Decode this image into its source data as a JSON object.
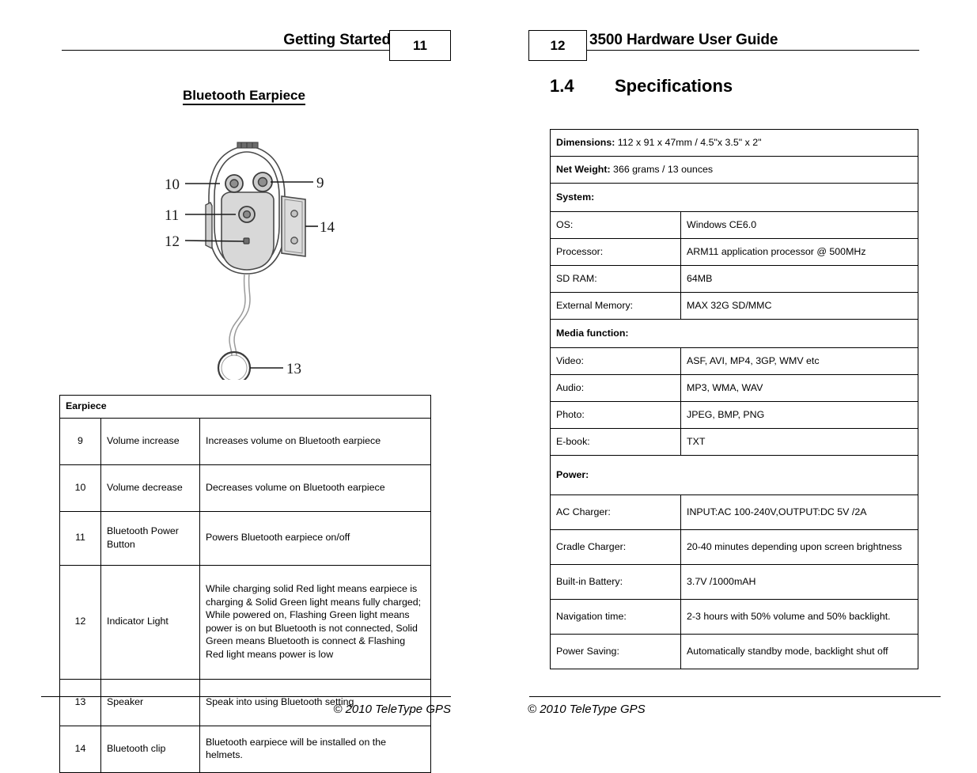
{
  "document": {
    "title": "3500 Hardware User Guide",
    "copyright": "© 2010 TeleType GPS"
  },
  "left_page": {
    "header": {
      "title": "Getting Started",
      "page_number": "11"
    },
    "section_title": "Bluetooth Earpiece",
    "figure": {
      "name": "bluetooth-earpiece-diagram",
      "callouts": [
        "9",
        "10",
        "11",
        "12",
        "13",
        "14"
      ]
    },
    "table": {
      "caption": "Earpiece",
      "rows": [
        {
          "num": "9",
          "part": "Volume increase",
          "desc": "Increases volume on Bluetooth earpiece"
        },
        {
          "num": "10",
          "part": "Volume decrease",
          "desc": "Decreases volume on Bluetooth earpiece"
        },
        {
          "num": "11",
          "part": "Bluetooth Power Button",
          "desc": "Powers Bluetooth earpiece on/off"
        },
        {
          "num": "12",
          "part": "Indicator Light",
          "desc": "While charging solid Red light means earpiece is charging & Solid Green light means fully charged; While powered on, Flashing Green light means power is on but Bluetooth is not connected, Solid Green means Bluetooth is connect & Flashing Red light means power is low"
        },
        {
          "num": "13",
          "part": "Speaker",
          "desc": "Speak into using Bluetooth setting"
        },
        {
          "num": "14",
          "part": "Bluetooth clip",
          "desc": "Bluetooth earpiece will be installed on the helmets."
        }
      ]
    },
    "footer": "© 2010 TeleType GPS"
  },
  "right_page": {
    "header": {
      "title": "3500 Hardware User Guide",
      "page_number": "12"
    },
    "heading": {
      "number": "1.4",
      "text": "Specifications"
    },
    "spec_table": {
      "rows": [
        {
          "type": "full",
          "label": "Dimensions:",
          "value": " 112 x 91 x 47mm / 4.5\"x 3.5\" x 2\""
        },
        {
          "type": "full",
          "label": "Net Weight:",
          "value": " 366 grams / 13 ounces"
        },
        {
          "type": "section",
          "label": "System:",
          "value": ""
        },
        {
          "type": "pair",
          "label": "OS:",
          "value": "Windows CE6.0"
        },
        {
          "type": "pair",
          "label": "Processor:",
          "value": "ARM11 application processor @ 500MHz"
        },
        {
          "type": "pair",
          "label": "SD RAM:",
          "value": "64MB"
        },
        {
          "type": "pair",
          "label": "External Memory:",
          "value": "MAX 32G SD/MMC"
        },
        {
          "type": "section",
          "label": "Media function:",
          "value": ""
        },
        {
          "type": "pair",
          "label": "Video:",
          "value": "ASF, AVI, MP4, 3GP, WMV etc"
        },
        {
          "type": "pair",
          "label": "Audio:",
          "value": "MP3, WMA, WAV"
        },
        {
          "type": "pair",
          "label": "Photo:",
          "value": "JPEG, BMP, PNG"
        },
        {
          "type": "pair",
          "label": "E-book:",
          "value": "TXT"
        },
        {
          "type": "section",
          "label": "Power:",
          "value": ""
        },
        {
          "type": "pair",
          "label": "AC Charger:",
          "value": "INPUT:AC 100-240V,OUTPUT:DC 5V /2A"
        },
        {
          "type": "pair",
          "label": "Cradle Charger:",
          "value": "20-40 minutes depending upon screen brightness"
        },
        {
          "type": "pair",
          "label": "Built-in Battery:",
          "value": "3.7V /1000mAH"
        },
        {
          "type": "pair",
          "label": "Navigation time:",
          "value": "2-3 hours with 50% volume and 50% backlight."
        },
        {
          "type": "pair",
          "label": "Power Saving:",
          "value": "Automatically standby mode, backlight shut off"
        }
      ]
    },
    "footer": "© 2010 TeleType GPS"
  },
  "colors": {
    "section_header_gray": "#bfbfbf",
    "rule": "#000000",
    "text": "#000000"
  }
}
